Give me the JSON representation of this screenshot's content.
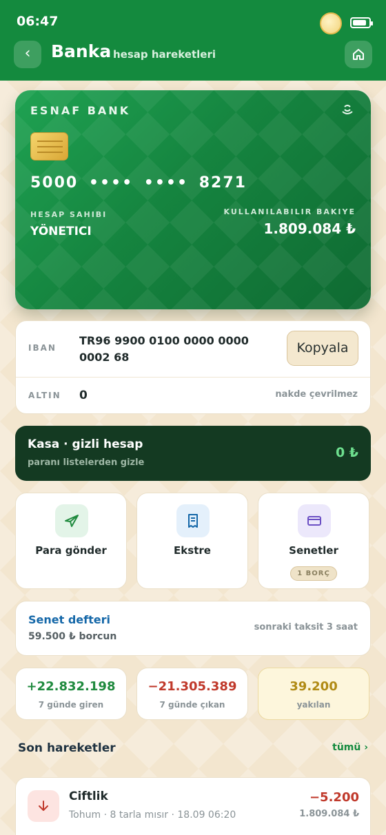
{
  "status": {
    "time": "06:47"
  },
  "header": {
    "title": "Banka",
    "subtitle": "hesap hareketleri"
  },
  "card": {
    "bank_name": "ESNAF BANK",
    "number": "5000  ••••  ••••  8271",
    "holder_label": "HESAP SAHIBI",
    "holder_name": "YÖNETICI",
    "balance_label": "KULLANILABILIR BAKIYE",
    "balance_value": "1.809.084 ₺"
  },
  "account": {
    "iban_label": "IBAN",
    "iban_value": "TR96 9900 0100 0000 0000 0002 68",
    "copy_label": "Kopyala",
    "gold_label": "ALTIN",
    "gold_value": "0",
    "gold_note": "nakde çevrilmez"
  },
  "kasa": {
    "title": "Kasa · gizli hesap",
    "subtitle": "paranı listelerden gizle",
    "value": "0 ₺"
  },
  "actions": [
    {
      "label": "Para gönder",
      "icon": "send-icon"
    },
    {
      "label": "Ekstre",
      "icon": "receipt-icon"
    },
    {
      "label": "Senetler",
      "icon": "card-icon",
      "badge": "1 BORÇ"
    }
  ],
  "senet": {
    "title": "Senet defteri",
    "subtitle": "59.500 ₺ borcun",
    "note": "sonraki taksit 3 saat"
  },
  "stats": [
    {
      "value": "+22.832.198",
      "label": "7 günde giren",
      "color": "#1f8a3e"
    },
    {
      "value": "−21.305.389",
      "label": "7 günde çıkan",
      "color": "#c0392b"
    },
    {
      "value": "39.200",
      "label": "yakılan",
      "color": "#b08a14"
    }
  ],
  "recent": {
    "title": "Son hareketler",
    "see_all": "tümü ›",
    "items": [
      {
        "title": "Ciftlik",
        "subtitle": "Tohum · 8 tarla mısır · 18.09 06:20",
        "amount": "−5.200",
        "balance": "1.809.084 ₺"
      }
    ]
  },
  "colors": {
    "primary": "#148a3e",
    "background": "#f3e6cf",
    "kasa": "#143a22"
  }
}
